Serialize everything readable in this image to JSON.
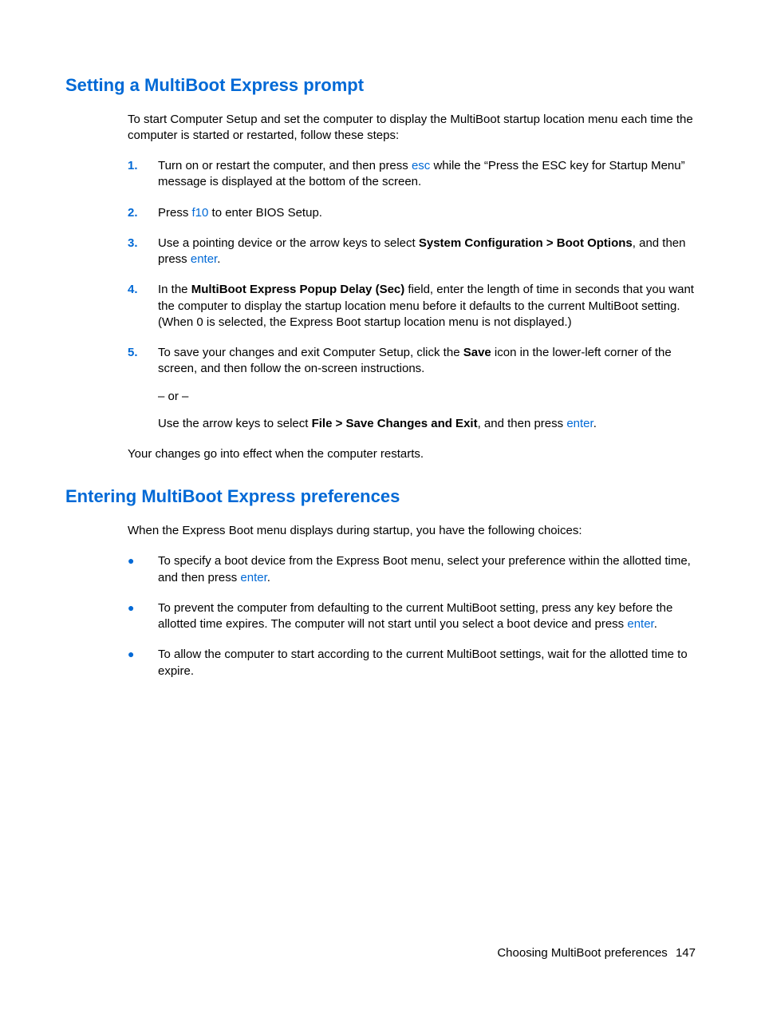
{
  "section1": {
    "heading": "Setting a MultiBoot Express prompt",
    "intro": "To start Computer Setup and set the computer to display the MultiBoot startup location menu each time the computer is started or restarted, follow these steps:",
    "steps": [
      {
        "num": "1.",
        "pre": "Turn on or restart the computer, and then press ",
        "key": "esc",
        "post": " while the “Press the ESC key for Startup Menu” message is displayed at the bottom of the screen."
      },
      {
        "num": "2.",
        "pre": "Press ",
        "key": "f10",
        "post": " to enter BIOS Setup."
      },
      {
        "num": "3.",
        "pre": "Use a pointing device or the arrow keys to select ",
        "bold": "System Configuration > Boot Options",
        "mid": ", and then press ",
        "key": "enter",
        "post": "."
      },
      {
        "num": "4.",
        "pre": "In the ",
        "bold": "MultiBoot Express Popup Delay (Sec)",
        "post": " field, enter the length of time in seconds that you want the computer to display the startup location menu before it defaults to the current MultiBoot setting. (When 0 is selected, the Express Boot startup location menu is not displayed.)"
      },
      {
        "num": "5.",
        "p1_pre": "To save your changes and exit Computer Setup, click the ",
        "p1_bold": "Save",
        "p1_post": " icon in the lower-left corner of the screen, and then follow the on-screen instructions.",
        "p2": "– or –",
        "p3_pre": "Use the arrow keys to select ",
        "p3_bold": "File > Save Changes and Exit",
        "p3_mid": ", and then press ",
        "p3_key": "enter",
        "p3_post": "."
      }
    ],
    "after": "Your changes go into effect when the computer restarts."
  },
  "section2": {
    "heading": "Entering MultiBoot Express preferences",
    "intro": "When the Express Boot menu displays during startup, you have the following choices:",
    "bullets": [
      {
        "pre": "To specify a boot device from the Express Boot menu, select your preference within the allotted time, and then press ",
        "key": "enter",
        "post": "."
      },
      {
        "pre": "To prevent the computer from defaulting to the current MultiBoot setting, press any key before the allotted time expires. The computer will not start until you select a boot device and press ",
        "key": "enter",
        "post": "."
      },
      {
        "pre": "To allow the computer to start according to the current MultiBoot settings, wait for the allotted time to expire."
      }
    ]
  },
  "footer": {
    "label": "Choosing MultiBoot preferences",
    "page": "147"
  }
}
